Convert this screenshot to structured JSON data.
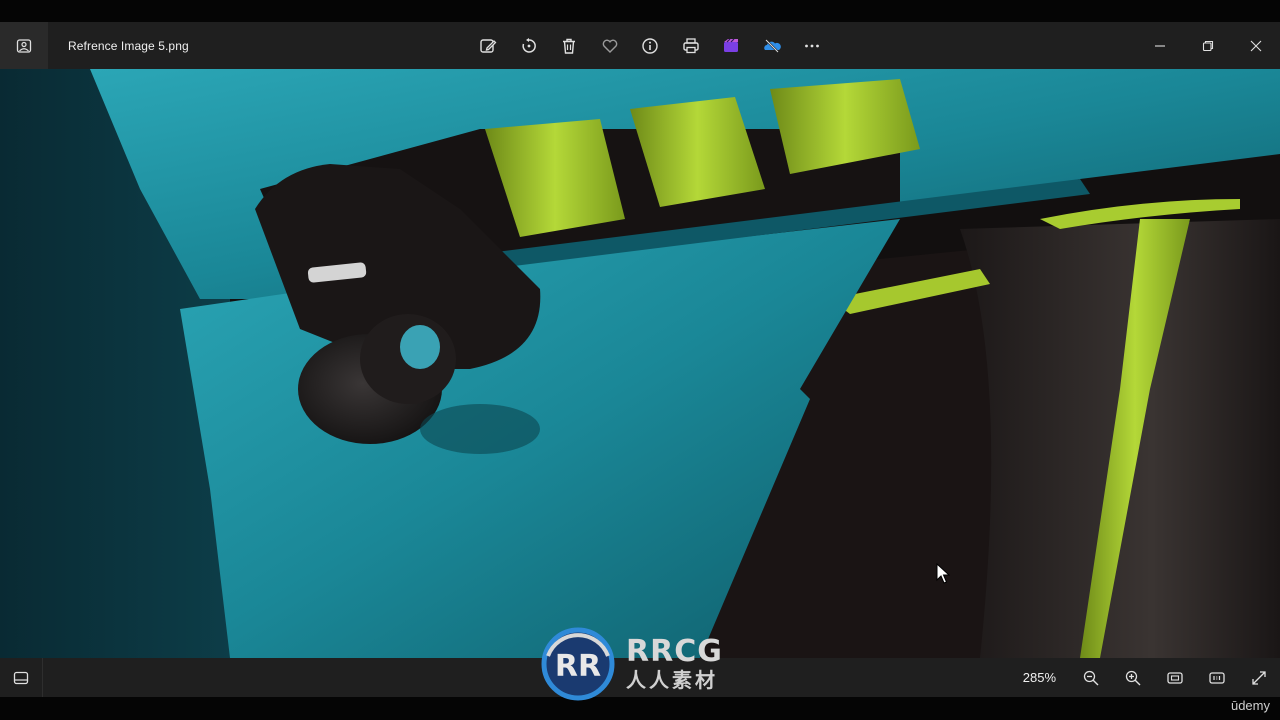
{
  "window": {
    "title": "Refrence Image 5.png",
    "app_icon": "photos-app-icon"
  },
  "toolbar": {
    "items": [
      {
        "name": "edit-image-button",
        "icon": "edit-icon"
      },
      {
        "name": "rotate-button",
        "icon": "rotate-icon"
      },
      {
        "name": "delete-button",
        "icon": "trash-icon"
      },
      {
        "name": "favorite-button",
        "icon": "heart-icon"
      },
      {
        "name": "file-info-button",
        "icon": "info-icon"
      },
      {
        "name": "print-button",
        "icon": "printer-icon"
      },
      {
        "name": "clipchamp-button",
        "icon": "clipchamp-icon"
      },
      {
        "name": "onedrive-button",
        "icon": "onedrive-icon"
      },
      {
        "name": "more-options-button",
        "icon": "ellipsis-icon"
      }
    ]
  },
  "window_controls": [
    "minimize-icon",
    "restore-icon",
    "close-icon"
  ],
  "statusbar": {
    "zoom": "285%",
    "buttons": [
      "zoom-out-icon",
      "zoom-in-icon",
      "fit-to-window-icon",
      "actual-size-icon",
      "fullscreen-icon"
    ]
  },
  "watermark": {
    "main": "RRCG",
    "sub": "人人素材"
  },
  "udemy_label": "ūdemy",
  "colors": {
    "teal": "#1d8a9a",
    "lime": "#9cc22a",
    "chrome": "#1f1f1f"
  }
}
